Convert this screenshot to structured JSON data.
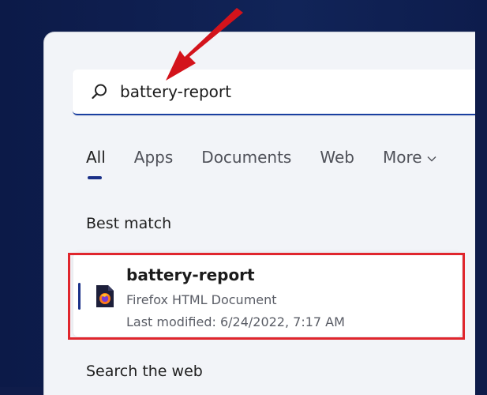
{
  "search": {
    "value": "battery-report",
    "placeholder": ""
  },
  "tabs": [
    {
      "label": "All",
      "active": true
    },
    {
      "label": "Apps",
      "active": false
    },
    {
      "label": "Documents",
      "active": false
    },
    {
      "label": "Web",
      "active": false
    },
    {
      "label": "More",
      "active": false
    }
  ],
  "best_match": {
    "title": "Best match",
    "result": {
      "name": "battery-report",
      "type": "Firefox HTML Document",
      "modified": "Last modified: 6/24/2022, 7:17 AM",
      "icon": "firefox-html-file-icon"
    }
  },
  "search_web": {
    "title": "Search the web"
  },
  "colors": {
    "accent": "#1a3088",
    "highlight": "#e0262d",
    "background": "#0f1c4a",
    "panel": "#f2f4f8"
  }
}
